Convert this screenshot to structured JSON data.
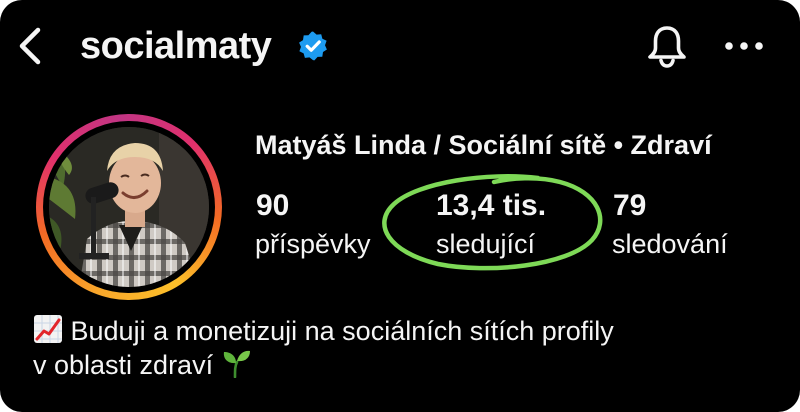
{
  "header": {
    "username": "socialmaty",
    "verified": true,
    "back_icon": "chevron-left-icon",
    "verified_icon": "verified-badge-icon",
    "bell_icon": "bell-icon",
    "more_icon": "more-horizontal-icon"
  },
  "profile": {
    "full_name": "Matyáš Linda / Sociální sítě • Zdraví",
    "avatar_icon": "profile-photo",
    "stats": [
      {
        "value": "90",
        "label": "příspěvky"
      },
      {
        "value": "13,4 tis.",
        "label": "sledující"
      },
      {
        "value": "79",
        "label": "sledování"
      }
    ],
    "bio": {
      "line1": "Buduji a monetizuji na sociálních sítích profily",
      "line2": "v oblasti zdraví",
      "leading_emoji": "chart-increasing-icon",
      "trailing_emoji": "seedling-icon"
    }
  },
  "annotation": {
    "color": "#7ed957",
    "shape": "ellipse-circle"
  },
  "colors": {
    "background": "#000000",
    "text": "#f5f5f5",
    "verified_blue": "#1d9bf0",
    "story_ring": [
      "#fcc02a",
      "#f36b24",
      "#e1306c",
      "#c13584"
    ]
  }
}
